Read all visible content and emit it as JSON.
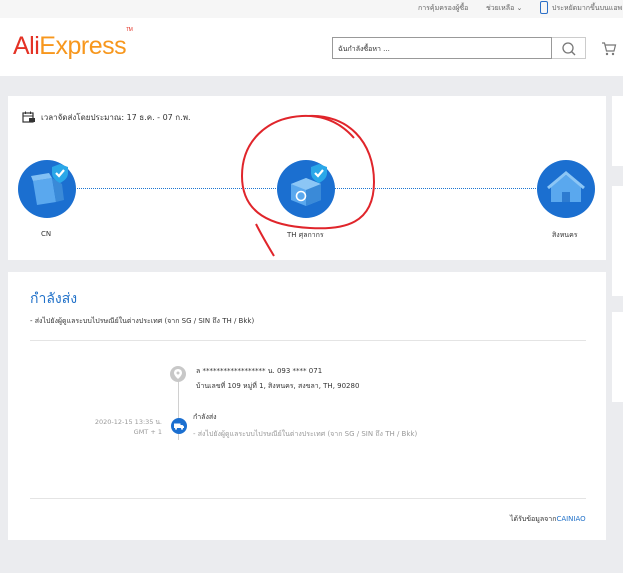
{
  "topbar": {
    "link1": "การคุ้มครองผู้ซื้อ",
    "link2": "ช่วยเหลือ",
    "link3": "ประหยัดมากขึ้นบนแอพ"
  },
  "header": {
    "logo_part1": "Ali",
    "logo_part2": "Express",
    "logo_tm": "TM",
    "search_placeholder": "ฉันกำลังซื้อหา ...",
    "icons": [
      "phone-icon",
      "search-icon",
      "cart-icon"
    ]
  },
  "shipping": {
    "estimate_text": "เวลาจัดส่งโดยประมาณ: 17 ธ.ค. - 07 ก.พ.",
    "nodes": [
      {
        "label": "CN",
        "icon": "package-check-icon"
      },
      {
        "label": "TH ศุลกากร",
        "icon": "customs-check-icon"
      },
      {
        "label": "สิงหนคร",
        "icon": "house-icon"
      }
    ]
  },
  "status": {
    "title": "กำลังส่ง",
    "description": "- ส่งไปยังผู้ดูแลระบบไปรษณีย์ในต่างประเทศ (จาก SG / SIN ถึง TH / Bkk)"
  },
  "timeline": {
    "address_line1": "ล ****************** น.   093 **** 071",
    "address_line2": "บ้านเลขที่ 109 หมู่ที่ 1,  สิงหนคร,  สงขลา,  TH,  90280",
    "event_time_line1": "2020-12-15 13:35 น.",
    "event_time_line2": "GMT + 1",
    "event_status": "กำลังส่ง",
    "event_description": "- ส่งไปยังผู้ดูแลระบบไปรษณีย์ในต่างประเทศ (จาก SG / SIN ถึง TH / Bkk)"
  },
  "footer": {
    "info_prefix": "ได้รับข้อมูลจาก",
    "info_source": "CAINIAO"
  },
  "colors": {
    "accent_blue": "#1b6fd0",
    "logo_red": "#e43225",
    "logo_orange": "#f7971d",
    "annotation_red": "#e0252b",
    "check_badge": "#2aa7e8"
  }
}
